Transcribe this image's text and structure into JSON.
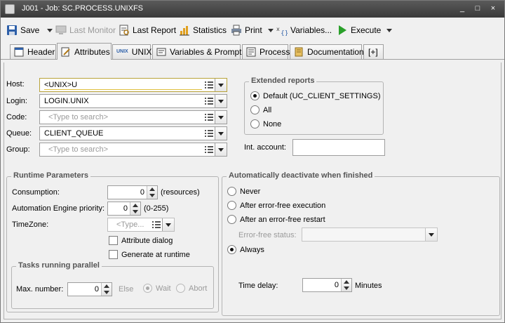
{
  "window": {
    "title": "J001 - Job: SC.PROCESS.UNIXFS",
    "controls": [
      "_",
      "□",
      "×"
    ]
  },
  "toolbar": {
    "save": "Save",
    "last_monitor": "Last Monitor",
    "last_report": "Last Report",
    "statistics": "Statistics",
    "print": "Print",
    "variables": "Variables...",
    "execute": "Execute"
  },
  "tabs": [
    {
      "label": "Header",
      "icon": "header-icon"
    },
    {
      "label": "Attributes",
      "icon": "attributes-icon"
    },
    {
      "label": "UNIX",
      "icon": "unix-icon",
      "icon_text": "UNIX"
    },
    {
      "label": "Variables & Prompts",
      "icon": "variables-icon"
    },
    {
      "label": "Process",
      "icon": "process-icon"
    },
    {
      "label": "Documentation",
      "icon": "documentation-icon"
    },
    {
      "label": "[+]",
      "icon": ""
    }
  ],
  "form": {
    "host": {
      "label": "Host:",
      "value": "<UNIX>U"
    },
    "login": {
      "label": "Login:",
      "value": "LOGIN.UNIX"
    },
    "code": {
      "label": "Code:",
      "placeholder": "<Type to search>"
    },
    "queue": {
      "label": "Queue:",
      "value": "CLIENT_QUEUE"
    },
    "group": {
      "label": "Group:",
      "placeholder": "<Type to search>"
    }
  },
  "extended_reports": {
    "title": "Extended reports",
    "options": [
      {
        "label": "Default (UC_CLIENT_SETTINGS)",
        "selected": true
      },
      {
        "label": "All",
        "selected": false
      },
      {
        "label": "None",
        "selected": false
      }
    ]
  },
  "int_account": {
    "label": "Int. account:",
    "value": ""
  },
  "runtime": {
    "title": "Runtime Parameters",
    "consumption": {
      "label": "Consumption:",
      "value": "0",
      "unit": "(resources)"
    },
    "priority": {
      "label": "Automation Engine priority:",
      "value": "0",
      "range": "(0-255)"
    },
    "timezone": {
      "label": "TimeZone:",
      "placeholder": "<Type..."
    },
    "attribute_dialog": {
      "label": "Attribute dialog",
      "checked": false
    },
    "generate_at_runtime": {
      "label": "Generate at runtime",
      "checked": false
    }
  },
  "tasks_parallel": {
    "title": "Tasks running parallel",
    "max_number": {
      "label": "Max. number:",
      "value": "0"
    },
    "else_label": "Else",
    "wait": {
      "label": "Wait",
      "selected": true
    },
    "abort": {
      "label": "Abort",
      "selected": false
    }
  },
  "deactivate": {
    "title": "Automatically deactivate when finished",
    "options": [
      {
        "label": "Never",
        "selected": false
      },
      {
        "label": "After error-free execution",
        "selected": false
      },
      {
        "label": "After an error-free restart",
        "selected": false
      },
      {
        "label": "Always",
        "selected": true
      }
    ],
    "error_free_status": {
      "label": "Error-free status:",
      "value": ""
    },
    "time_delay": {
      "label": "Time delay:",
      "value": "0",
      "unit": "Minutes"
    }
  }
}
